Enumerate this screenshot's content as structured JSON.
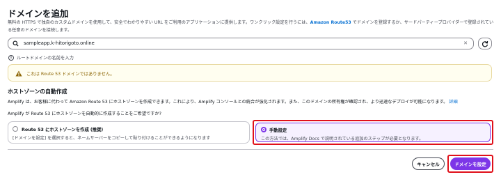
{
  "page": {
    "title": "ドメインを追加",
    "description_before_link": "無料の HTTPS で独自のカスタムドメインを使用して、安全でわかりやすい URL をご利用のアプリケーションに提供します。ワンクリック設定を行うには、",
    "description_link": "Amazon Route53",
    "description_after_link": " でドメインを登録するか、サードパーティープロバイダーで登録されている任意のドメインを接続します。"
  },
  "domain_input": {
    "value": "sampleapp.k-hitorigoto.online",
    "icon": "search-icon",
    "clear_icon": "close-icon"
  },
  "refresh_icon": "refresh-icon",
  "hint": {
    "icon": "info-icon",
    "text": "ルートドメインの名前を入力"
  },
  "warning": {
    "icon": "warning-icon",
    "text": "これは Route 53 ドメインではありません。"
  },
  "hosted_zone": {
    "title": "ホストゾーンの自動作成",
    "description": "Amplify は、お客様に代わって Amazon Route 53 にホストゾーンを作成できます。これにより、Amplify コンソールとの統合が強化されます。また、このドメインの所有権が確認され、より迅速なデプロイが可能になります。",
    "details_link": "詳細",
    "question": "Amplify が Route 53 にホストゾーンを自動的に作成することをご希望ですか?",
    "options": [
      {
        "title": "Route 53 にホストゾーンを作成 (推奨)",
        "description": "[ドメインを設定] を選択すると、ネームサーバーをコピーして貼り付けることができるようになります",
        "selected": false
      },
      {
        "title": "手動設定",
        "description": "この方法では、Amplify Docs で説明されている追加のステップが必要となります。",
        "selected": true
      }
    ]
  },
  "actions": {
    "cancel_label": "キャンセル",
    "confirm_label": "ドメインを設定"
  },
  "colors": {
    "accent": "#7d36e8",
    "link": "#0972d3",
    "highlight": "#e0101a",
    "warning_text": "#8d6605",
    "warning_bg": "#fffef0"
  }
}
